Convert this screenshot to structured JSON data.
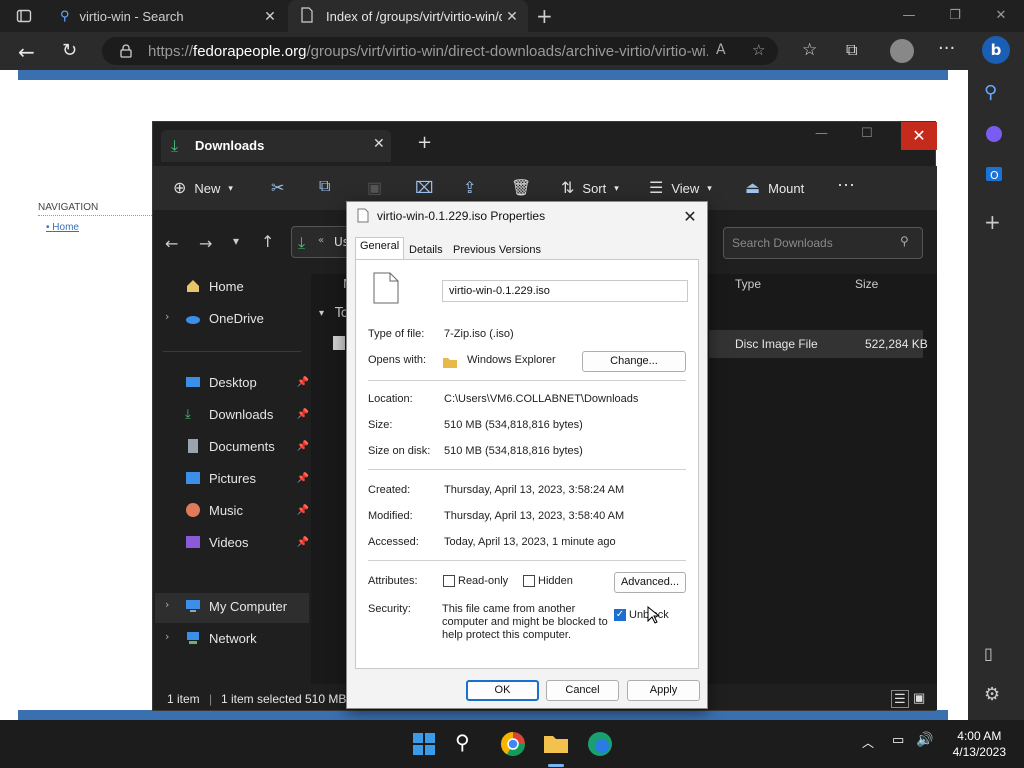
{
  "browser": {
    "tabs": [
      {
        "label": "virtio-win - Search"
      },
      {
        "label": "Index of /groups/virt/virtio-win/d"
      }
    ],
    "url_prefix": "https://",
    "url_host": "fedorapeople.org",
    "url_path": "/groups/virt/virtio-win/direct-downloads/archive-virtio/virtio-wi..."
  },
  "webpage": {
    "nav_title": "NAVIGATION",
    "nav_home": "Home"
  },
  "explorer": {
    "tab_title": "Downloads",
    "toolbar": {
      "new_label": "New",
      "sort_label": "Sort",
      "view_label": "View",
      "mount_label": "Mount"
    },
    "search_placeholder": "Search Downloads",
    "breadcrumb_partial": "Us",
    "nav": {
      "home": "Home",
      "onedrive": "OneDrive",
      "desktop": "Desktop",
      "downloads": "Downloads",
      "documents": "Documents",
      "pictures": "Pictures",
      "music": "Music",
      "videos": "Videos",
      "mycomputer": "My Computer",
      "network": "Network"
    },
    "columns": {
      "name_partial": "N",
      "type": "Type",
      "size": "Size"
    },
    "group_partial": "To",
    "file_row": {
      "type": "Disc Image File",
      "size": "522,284 KB"
    },
    "status": {
      "count": "1 item",
      "selected": "1 item selected",
      "size": "510 MB"
    }
  },
  "dialog": {
    "title": "virtio-win-0.1.229.iso Properties",
    "tabs": [
      "General",
      "Details",
      "Previous Versions"
    ],
    "filename": "virtio-win-0.1.229.iso",
    "labels": {
      "type_of_file": "Type of file:",
      "opens_with": "Opens with:",
      "location": "Location:",
      "size": "Size:",
      "size_on_disk": "Size on disk:",
      "created": "Created:",
      "modified": "Modified:",
      "accessed": "Accessed:",
      "attributes": "Attributes:",
      "security": "Security:"
    },
    "values": {
      "type_of_file": "7-Zip.iso (.iso)",
      "opens_with": "Windows Explorer",
      "location": "C:\\Users\\VM6.COLLABNET\\Downloads",
      "size": "510 MB (534,818,816 bytes)",
      "size_on_disk": "510 MB (534,818,816 bytes)",
      "created": "Thursday, April 13, 2023, 3:58:24 AM",
      "modified": "Thursday, April 13, 2023, 3:58:40 AM",
      "accessed": "Today, April 13, 2023, 1 minute ago",
      "security_line1": "This file came from another",
      "security_line2": "computer and might be blocked to",
      "security_line3": "help protect this computer."
    },
    "checkboxes": {
      "readonly": "Read-only",
      "hidden": "Hidden",
      "unblock": "Unblock"
    },
    "buttons": {
      "change": "Change...",
      "advanced": "Advanced...",
      "ok": "OK",
      "cancel": "Cancel",
      "apply": "Apply"
    }
  },
  "taskbar": {
    "time": "4:00 AM",
    "date": "4/13/2023"
  }
}
